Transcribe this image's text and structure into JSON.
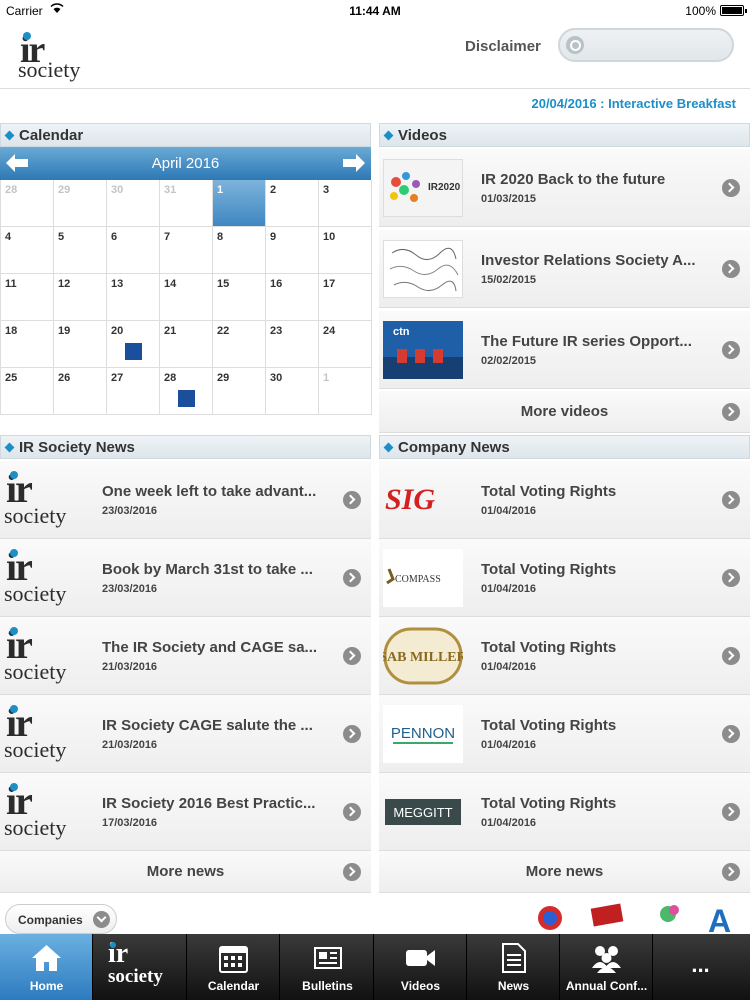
{
  "status_bar": {
    "carrier": "Carrier",
    "time": "11:44 AM",
    "battery": "100%"
  },
  "header": {
    "logo_line1": "ir",
    "logo_line2": "society",
    "disclaimer": "Disclaimer",
    "search_placeholder": ""
  },
  "ticker": "20/04/2016 : Interactive Breakfast",
  "calendar": {
    "title": "Calendar",
    "month": "April 2016",
    "weeks": [
      [
        {
          "d": "28",
          "dim": true
        },
        {
          "d": "29",
          "dim": true
        },
        {
          "d": "30",
          "dim": true
        },
        {
          "d": "31",
          "dim": true
        },
        {
          "d": "1",
          "today": true
        },
        {
          "d": "2"
        },
        {
          "d": "3"
        }
      ],
      [
        {
          "d": "4"
        },
        {
          "d": "5"
        },
        {
          "d": "6"
        },
        {
          "d": "7"
        },
        {
          "d": "8"
        },
        {
          "d": "9"
        },
        {
          "d": "10"
        }
      ],
      [
        {
          "d": "11"
        },
        {
          "d": "12"
        },
        {
          "d": "13"
        },
        {
          "d": "14"
        },
        {
          "d": "15"
        },
        {
          "d": "16"
        },
        {
          "d": "17"
        }
      ],
      [
        {
          "d": "18"
        },
        {
          "d": "19"
        },
        {
          "d": "20",
          "event": true
        },
        {
          "d": "21"
        },
        {
          "d": "22"
        },
        {
          "d": "23"
        },
        {
          "d": "24"
        }
      ],
      [
        {
          "d": "25"
        },
        {
          "d": "26"
        },
        {
          "d": "27"
        },
        {
          "d": "28",
          "event": true
        },
        {
          "d": "29"
        },
        {
          "d": "30"
        },
        {
          "d": "1",
          "dim": true
        }
      ]
    ]
  },
  "videos": {
    "title": "Videos",
    "items": [
      {
        "title": "IR 2020 Back to the future",
        "date": "01/03/2015",
        "thumb_text": "IR2020"
      },
      {
        "title": "Investor Relations Society A...",
        "date": "15/02/2015",
        "thumb_text": ""
      },
      {
        "title": "The Future IR series Opport...",
        "date": "02/02/2015",
        "thumb_text": "ctn"
      }
    ],
    "more": "More videos"
  },
  "ir_news": {
    "title": "IR Society News",
    "items": [
      {
        "title": "One week left to take advant...",
        "date": "23/03/2016"
      },
      {
        "title": "Book by March 31st to take ...",
        "date": "23/03/2016"
      },
      {
        "title": "The IR Society and CAGE sa...",
        "date": "21/03/2016"
      },
      {
        "title": "IR Society CAGE salute the ...",
        "date": "21/03/2016"
      },
      {
        "title": "IR Society 2016 Best Practic...",
        "date": "17/03/2016"
      }
    ],
    "more": "More news"
  },
  "company_news": {
    "title": "Company News",
    "items": [
      {
        "title": "Total Voting Rights",
        "date": "01/04/2016",
        "logo": "SIG"
      },
      {
        "title": "Total Voting Rights",
        "date": "01/04/2016",
        "logo": "COMPASS"
      },
      {
        "title": "Total Voting Rights",
        "date": "01/04/2016",
        "logo": "SAB MILLER"
      },
      {
        "title": "Total Voting Rights",
        "date": "01/04/2016",
        "logo": "PENNON"
      },
      {
        "title": "Total Voting Rights",
        "date": "01/04/2016",
        "logo": "MEGGITT"
      }
    ],
    "more": "More news"
  },
  "companies_button": "Companies",
  "tabs": [
    {
      "label": "Home",
      "icon": "home-icon",
      "active": true
    },
    {
      "label": "",
      "icon": "ir-society-logo-icon"
    },
    {
      "label": "Calendar",
      "icon": "calendar-icon"
    },
    {
      "label": "Bulletins",
      "icon": "bulletins-icon"
    },
    {
      "label": "Videos",
      "icon": "video-camera-icon"
    },
    {
      "label": "News",
      "icon": "news-document-icon"
    },
    {
      "label": "Annual Conf...",
      "icon": "people-icon"
    },
    {
      "label": "...",
      "icon": "more-icon"
    }
  ],
  "colors": {
    "accent": "#1c8fc9",
    "calendar_bar": "#2d78b5",
    "event": "#1b4f9c"
  }
}
